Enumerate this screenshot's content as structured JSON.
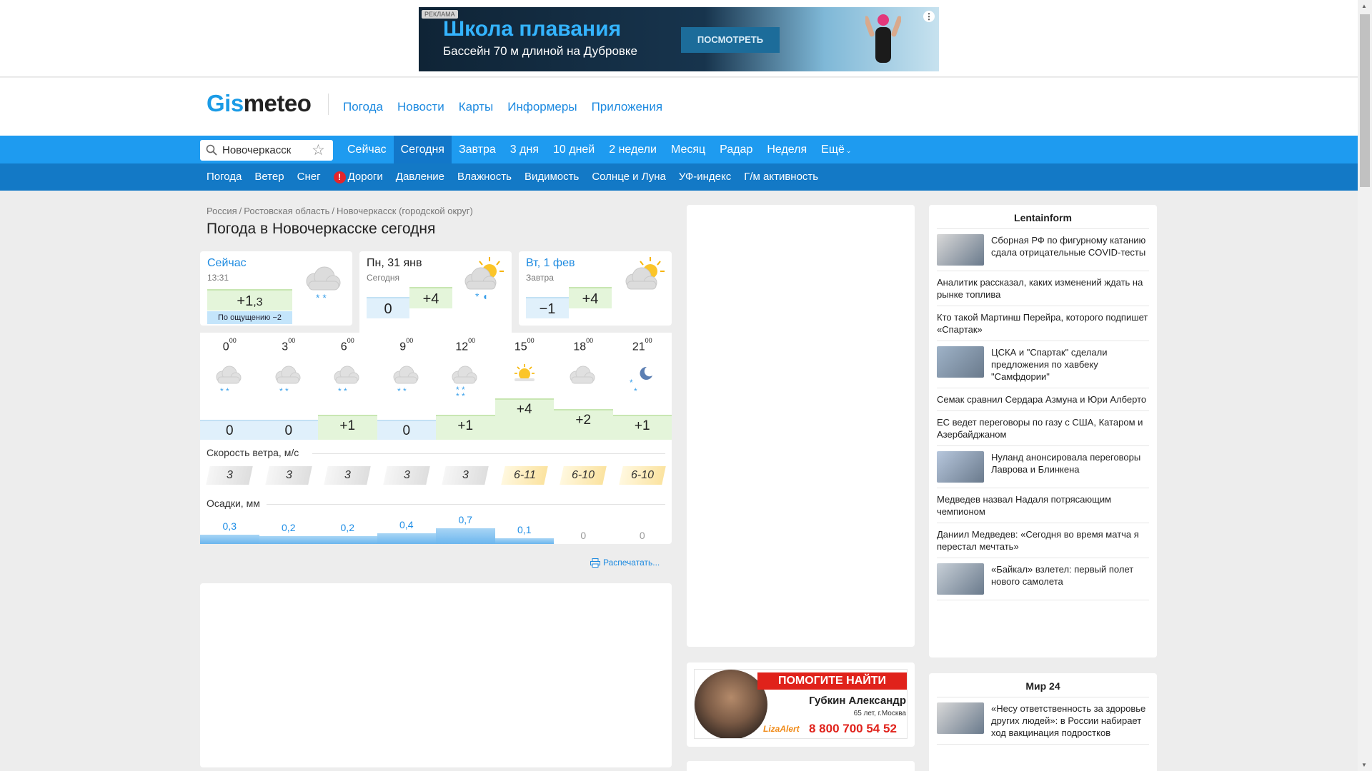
{
  "ad": {
    "badge": "РЕКЛАМА",
    "title": "Школа плавания",
    "subtitle": "Бассейн 70 м длиной на Дубровке",
    "button": "ПОСМОТРЕТЬ"
  },
  "logo": {
    "part1": "Gis",
    "part2": "meteo"
  },
  "topnav": [
    "Погода",
    "Новости",
    "Карты",
    "Информеры",
    "Приложения"
  ],
  "search": {
    "city": "Новочеркасск"
  },
  "tabs1": [
    "Сейчас",
    "Сегодня",
    "Завтра",
    "3 дня",
    "10 дней",
    "2 недели",
    "Месяц",
    "Радар",
    "Неделя",
    "Ещё"
  ],
  "tabs1_active": "Сегодня",
  "tabs2": [
    "Погода",
    "Ветер",
    "Снег",
    "Дороги",
    "Давление",
    "Влажность",
    "Видимость",
    "Солнце и Луна",
    "УФ-индекс",
    "Г/м активность"
  ],
  "breadcrumbs": [
    "Россия",
    "Ростовская область",
    "Новочеркасск (городской округ)"
  ],
  "page_title": "Погода в Новочеркасске сегодня",
  "now": {
    "title": "Сейчас",
    "time": "13:31",
    "temp": "+1",
    "temp_decimal": ",3",
    "feels": "По ощущению −2"
  },
  "today": {
    "title": "Пн, 31 янв",
    "sub": "Сегодня",
    "tmin": "0",
    "tmax": "+4"
  },
  "tomorrow": {
    "title": "Вт, 1 фев",
    "sub": "Завтра",
    "tmin": "−1",
    "tmax": "+4"
  },
  "hourly": {
    "hours": [
      "0",
      "3",
      "6",
      "9",
      "12",
      "15",
      "18",
      "21"
    ],
    "minutes": "00",
    "icons": [
      "moon-cloud-snow",
      "cloud-snow",
      "cloud-snow",
      "cloud-snow",
      "cloud-snow-heavy",
      "sun-cloud",
      "cloud",
      "moon-snow"
    ],
    "temps": [
      "0",
      "0",
      "+1",
      "0",
      "+1",
      "+4",
      "+2",
      "+1"
    ],
    "temp_values": [
      0,
      0,
      1,
      0,
      1,
      4,
      2,
      1
    ],
    "wind_label": "Скорость ветра, м/с",
    "wind": [
      "3",
      "3",
      "3",
      "3",
      "3",
      "6-11",
      "6-10",
      "6-10"
    ],
    "wind_strong": [
      false,
      false,
      false,
      false,
      false,
      true,
      true,
      true
    ],
    "precip_label": "Осадки, мм",
    "precip": [
      "0,3",
      "0,2",
      "0,2",
      "0,4",
      "0,7",
      "0,1",
      "0",
      "0"
    ],
    "precip_values": [
      0.3,
      0.2,
      0.2,
      0.4,
      0.7,
      0.1,
      0,
      0
    ]
  },
  "print_label": "Распечатать...",
  "sos": {
    "head": "ПОМОГИТЕ НАЙТИ ЧЕЛОВЕКА",
    "name": "Губкин Александр",
    "age": "65 лет, г.Москва",
    "org": "LizaAlert",
    "phone": "8 800 700 54 52"
  },
  "lentainform": {
    "title": "Lentainform",
    "items": [
      {
        "text": "Сборная РФ по фигурному катанию сдала отрицательные COVID-тесты",
        "thumb": true
      },
      {
        "text": "Аналитик рассказал, каких изменений ждать на рынке топлива",
        "thumb": false
      },
      {
        "text": "Кто такой Мартинш Перейра, которого подпишет «Спартак»",
        "thumb": false
      },
      {
        "text": "ЦСКА и \"Спартак\" сделали предложения по хавбеку \"Самфдории\"",
        "thumb": true
      },
      {
        "text": "Семак сравнил Сердара Азмуна и Юри Алберто",
        "thumb": false
      },
      {
        "text": "ЕС ведет переговоры по газу с США, Катаром и Азербайджаном",
        "thumb": false
      },
      {
        "text": "Нуланд анонсировала переговоры Лаврова и Блинкена",
        "thumb": true
      },
      {
        "text": "Медведев назвал Надаля потрясающим чемпионом",
        "thumb": false
      },
      {
        "text": "Даниил Медведев: «Сегодня во время матча я перестал мечтать»",
        "thumb": false
      },
      {
        "text": "«Байкал» взлетел: первый полет нового самолета",
        "thumb": true
      }
    ]
  },
  "mir24": {
    "title": "Мир 24",
    "items": [
      {
        "text": "«Несу ответственность за здоровье других людей»: в России набирает ход вакцинация подростков",
        "thumb": true
      }
    ]
  }
}
